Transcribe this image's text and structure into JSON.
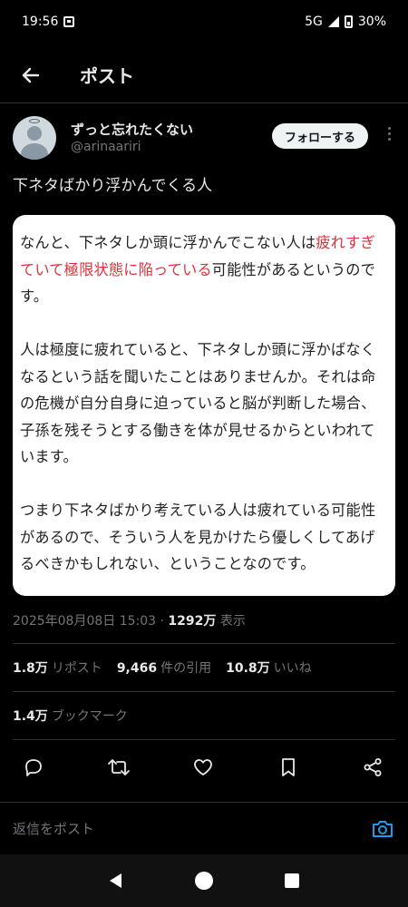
{
  "status_bar": {
    "time": "19:56",
    "network": "5G",
    "battery": "30%"
  },
  "header": {
    "title": "ポスト"
  },
  "author": {
    "display_name": "ずっと忘れたくない",
    "handle": "@arinaariri",
    "follow_label": "フォローする"
  },
  "post": {
    "text": "下ネタばかり浮かんでくる人",
    "media": {
      "p1_a": "なんと、下ネタしか頭に浮かんでこない人は",
      "p1_red": "疲れすぎていて極限状態に陥っている",
      "p1_b": "可能性があるというのです。",
      "p2": "人は極度に疲れていると、下ネタしか頭に浮かばなくなるという話を聞いたことはありませんか。それは命の危機が自分自身に迫っていると脳が判断した場合、子孫を残そうとする働きを体が見せるからといわれています。",
      "p3": "つまり下ネタばかり考えている人は疲れている可能性があるので、そういう人を見かけたら優しくしてあげるべきかもしれない、ということなのです。"
    },
    "timestamp": "2025年08月08日 15:03 · ",
    "views_count": "1292万",
    "views_label": " 表示"
  },
  "stats": {
    "reposts": {
      "count": "1.8万",
      "label": "リポスト"
    },
    "quotes": {
      "count": "9,466",
      "label": "件の引用"
    },
    "likes": {
      "count": "10.8万",
      "label": "いいね"
    },
    "bookmarks": {
      "count": "1.4万",
      "label": "ブックマーク"
    }
  },
  "actions": [
    "reply-icon",
    "repost-icon",
    "like-icon",
    "bookmark-icon",
    "share-icon"
  ],
  "reply_bar": {
    "placeholder": "返信をポスト"
  },
  "colors": {
    "accent": "#1d9bf0",
    "highlight_red": "#e0303a",
    "background": "#000000"
  }
}
